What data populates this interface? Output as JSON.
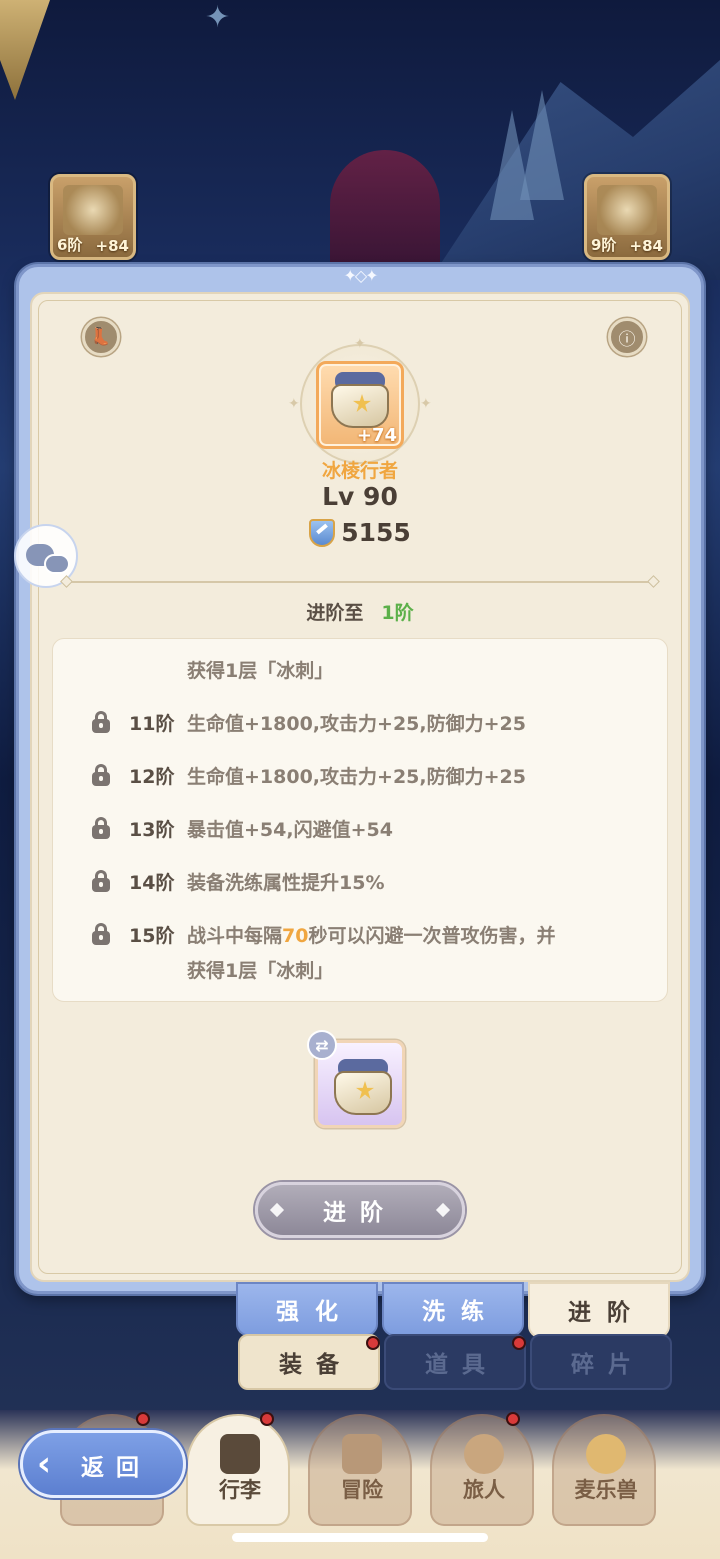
{
  "equip_slots": [
    {
      "level": "6阶",
      "bonus": "+84"
    },
    {
      "level": "9阶",
      "bonus": "+84"
    }
  ],
  "item": {
    "name": "冰棱行者",
    "enhance": "+74",
    "level": "Lv 90",
    "power": "5155"
  },
  "advance": {
    "title_prefix": "进阶至",
    "target_tier": "1阶",
    "intro": "获得1层「冰刺」",
    "tiers": [
      {
        "tier": "11阶",
        "desc": "生命值+1800,攻击力+25,防御力+25"
      },
      {
        "tier": "12阶",
        "desc": "生命值+1800,攻击力+25,防御力+25"
      },
      {
        "tier": "13阶",
        "desc": "暴击值+54,闪避值+54"
      },
      {
        "tier": "14阶",
        "desc": "装备洗练属性提升15%"
      },
      {
        "tier": "15阶",
        "desc_before": "战斗中每隔",
        "desc_num": "70",
        "desc_after": "秒可以闪避一次普攻伤害，并",
        "desc_line2": "获得1层「冰刺」"
      }
    ],
    "button_label": "进阶"
  },
  "subtabs": [
    "强化",
    "洗练",
    "进阶"
  ],
  "maintabs": [
    "装备",
    "道具",
    "碎片"
  ],
  "nav": {
    "back_label": "返回",
    "items": [
      "行李",
      "冒险",
      "旅人",
      "麦乐兽"
    ]
  },
  "colors": {
    "accent_orange": "#f0a640",
    "accent_green": "#5cb04a",
    "panel_blue": "#aec3ea",
    "panel_cream": "#f3ecdc"
  }
}
